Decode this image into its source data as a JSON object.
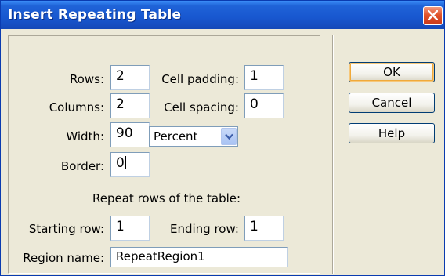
{
  "window": {
    "title": "Insert Repeating Table"
  },
  "form": {
    "rows_label": "Rows:",
    "rows_value": "2",
    "columns_label": "Columns:",
    "columns_value": "2",
    "width_label": "Width:",
    "width_value": "90",
    "width_unit_selected": "Percent",
    "border_label": "Border:",
    "border_value": "0",
    "cell_padding_label": "Cell padding:",
    "cell_padding_value": "1",
    "cell_spacing_label": "Cell spacing:",
    "cell_spacing_value": "0",
    "repeat_heading": "Repeat rows of the table:",
    "starting_row_label": "Starting row:",
    "starting_row_value": "1",
    "ending_row_label": "Ending row:",
    "ending_row_value": "1",
    "region_name_label": "Region name:",
    "region_name_value": "RepeatRegion1"
  },
  "buttons": {
    "ok": "OK",
    "cancel": "Cancel",
    "help": "Help"
  },
  "icons": {
    "close": "close-icon",
    "dropdown": "chevron-down-icon"
  },
  "colors": {
    "titlebar": "#1857cf",
    "dialog_bg": "#ece9d8",
    "close_button": "#e1542b",
    "default_button_ring": "#f0a93a"
  }
}
